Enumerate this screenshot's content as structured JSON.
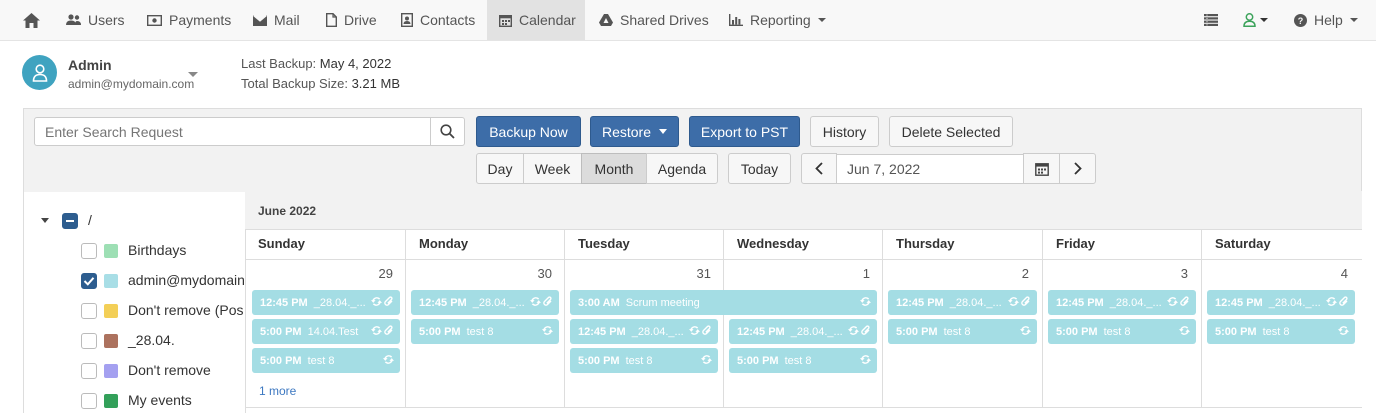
{
  "nav": {
    "items": [
      {
        "label": "Users",
        "icon": "users-icon"
      },
      {
        "label": "Payments",
        "icon": "payments-icon"
      },
      {
        "label": "Mail",
        "icon": "mail-icon"
      },
      {
        "label": "Drive",
        "icon": "drive-icon"
      },
      {
        "label": "Contacts",
        "icon": "contacts-icon"
      },
      {
        "label": "Calendar",
        "icon": "calendar-icon"
      },
      {
        "label": "Shared Drives",
        "icon": "shared-drives-icon"
      },
      {
        "label": "Reporting",
        "icon": "reporting-icon"
      }
    ],
    "active": "Calendar",
    "help_label": "Help"
  },
  "account": {
    "name": "Admin",
    "email": "admin@mydomain.com",
    "last_backup_label": "Last Backup:",
    "last_backup_value": "May 4, 2022",
    "total_size_label": "Total Backup Size:",
    "total_size_value": "3.21 MB"
  },
  "toolbar": {
    "search_placeholder": "Enter Search Request",
    "backup_now": "Backup Now",
    "restore": "Restore",
    "export_pst": "Export to PST",
    "history": "History",
    "delete_selected": "Delete Selected",
    "view_day": "Day",
    "view_week": "Week",
    "view_month": "Month",
    "view_agenda": "Agenda",
    "active_view": "Month",
    "today": "Today",
    "date_value": "Jun 7, 2022"
  },
  "tree": {
    "root": "/",
    "items": [
      {
        "label": "Birthdays",
        "color": "#9ddfb4",
        "checked": false
      },
      {
        "label": "admin@mydomain.com",
        "color": "#a8dee6",
        "checked": true
      },
      {
        "label": "Don't remove (Pos",
        "color": "#f3cf57",
        "checked": false
      },
      {
        "label": "_28.04.",
        "color": "#ac725e",
        "checked": false
      },
      {
        "label": "Don't remove",
        "color": "#a4a0f0",
        "checked": false
      },
      {
        "label": "My events",
        "color": "#33a05a",
        "checked": false
      }
    ]
  },
  "calendar": {
    "month_label": "June 2022",
    "weekdays": [
      "Sunday",
      "Monday",
      "Tuesday",
      "Wednesday",
      "Thursday",
      "Friday",
      "Saturday"
    ],
    "day_numbers": [
      "29",
      "30",
      "31",
      "1",
      "2",
      "3",
      "4"
    ],
    "events": {
      "sun_1": {
        "time": "12:45 PM",
        "title": "_28.04._..."
      },
      "sun_2": {
        "time": "5:00 PM",
        "title": "14.04.Test"
      },
      "sun_3": {
        "time": "5:00 PM",
        "title": "test 8"
      },
      "mon_1": {
        "time": "12:45 PM",
        "title": "_28.04._..."
      },
      "mon_2": {
        "time": "5:00 PM",
        "title": "test 8"
      },
      "tue_span": {
        "time": "3:00 AM",
        "title": "Scrum meeting"
      },
      "tue_2": {
        "time": "12:45 PM",
        "title": "_28.04._..."
      },
      "tue_3": {
        "time": "5:00 PM",
        "title": "test 8"
      },
      "wed_2": {
        "time": "12:45 PM",
        "title": "_28.04._..."
      },
      "wed_3": {
        "time": "5:00 PM",
        "title": "test 8"
      },
      "thu_1": {
        "time": "12:45 PM",
        "title": "_28.04._..."
      },
      "thu_2": {
        "time": "5:00 PM",
        "title": "test 8"
      },
      "fri_1": {
        "time": "12:45 PM",
        "title": "_28.04._..."
      },
      "fri_2": {
        "time": "5:00 PM",
        "title": "test 8"
      },
      "sat_1": {
        "time": "12:45 PM",
        "title": "_28.04._..."
      },
      "sat_2": {
        "time": "5:00 PM",
        "title": "test 8"
      }
    },
    "more_label": "1 more",
    "event_color": "#a4dde4"
  }
}
